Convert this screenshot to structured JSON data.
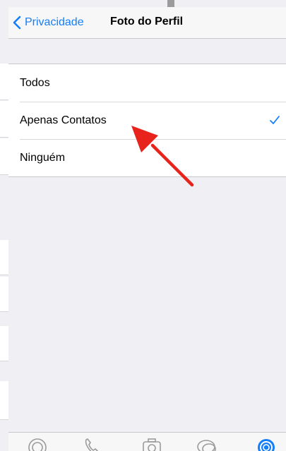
{
  "navbar": {
    "back_label": "Privacidade",
    "title": "Foto do Perfil"
  },
  "options": [
    {
      "label": "Todos",
      "selected": false
    },
    {
      "label": "Apenas Contatos",
      "selected": true
    },
    {
      "label": "Ninguém",
      "selected": false
    }
  ],
  "colors": {
    "accent": "#147efb",
    "annotation": "#e8231b",
    "background": "#efeff4"
  },
  "icons": {
    "back": "chevron-left-icon",
    "selected": "checkmark-icon",
    "tabs": [
      "status-icon",
      "phone-icon",
      "camera-icon",
      "chat-bubbles-icon",
      "settings-gear-icon"
    ]
  }
}
